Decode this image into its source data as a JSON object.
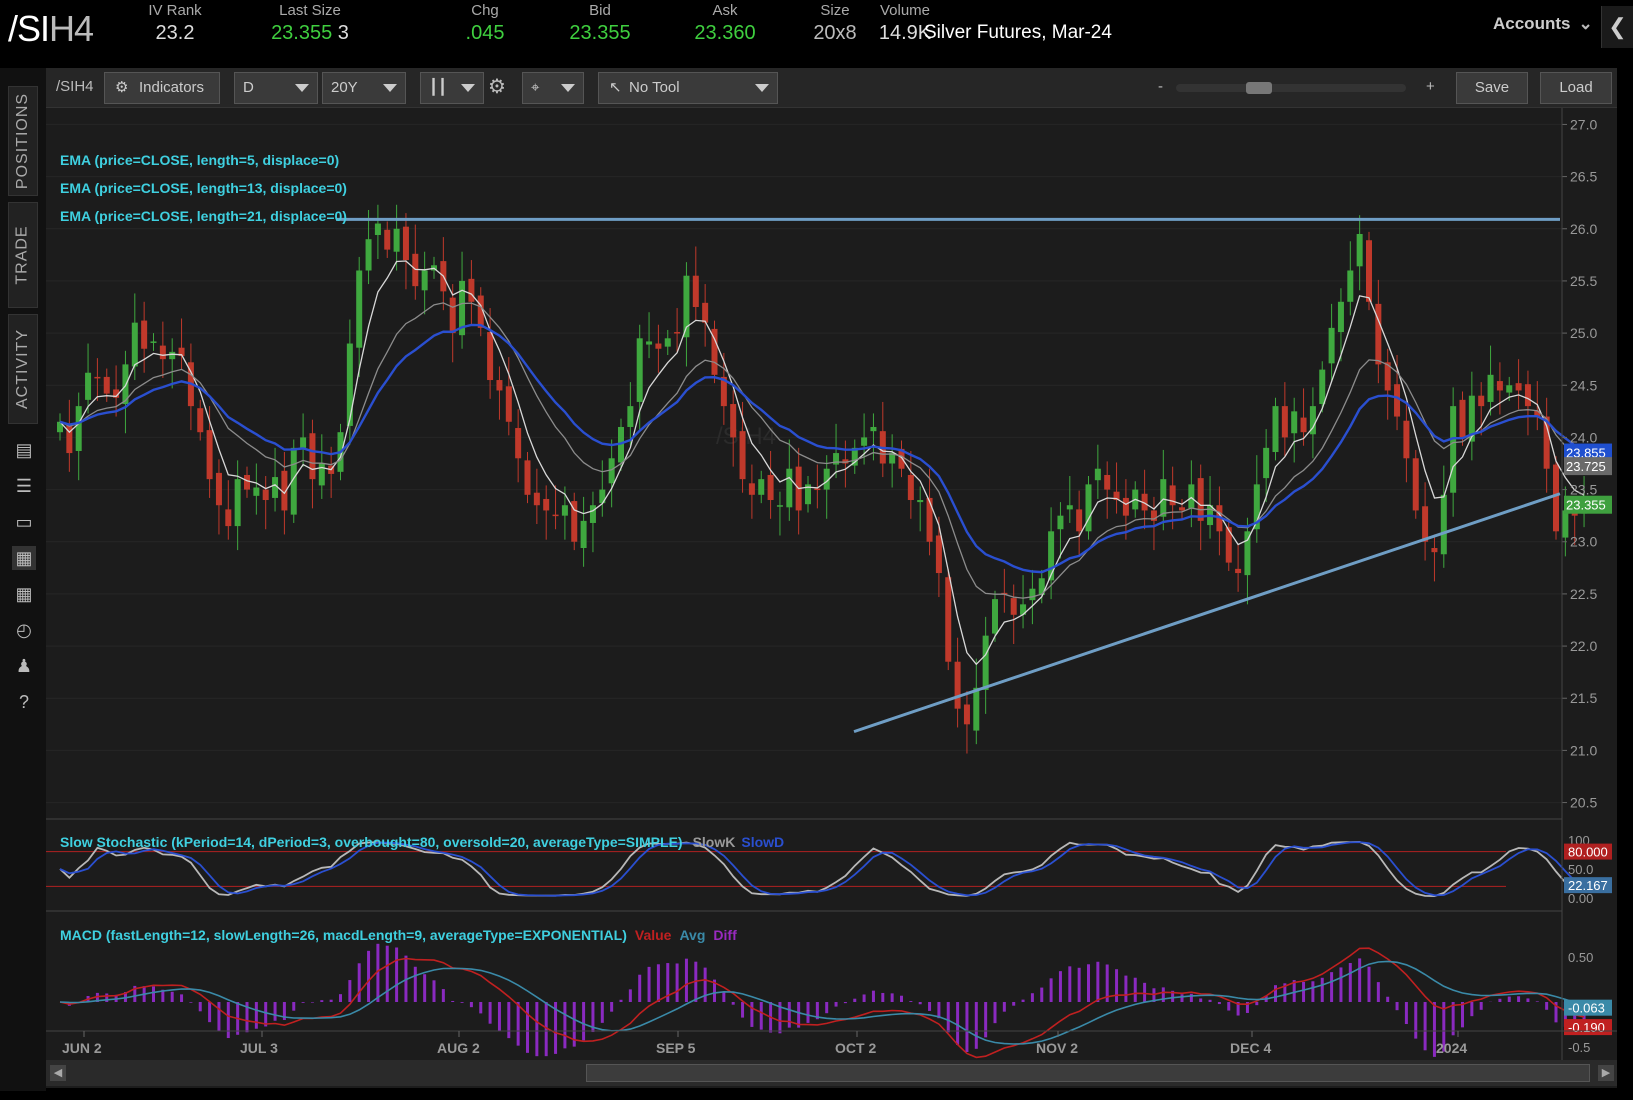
{
  "header": {
    "symbol_a": "/SI",
    "symbol_b": "H4",
    "quotes": [
      {
        "label": "IV Rank",
        "value": "23.2",
        "color": "#dddddd"
      },
      {
        "label": "Last Size",
        "value": "23.355",
        "value2": "3",
        "color": "#3fcf3f"
      },
      {
        "label": "Chg",
        "value": ".045",
        "color": "#3fcf3f"
      },
      {
        "label": "Bid",
        "value": "23.355",
        "color": "#3fcf3f"
      },
      {
        "label": "Ask",
        "value": "23.360",
        "color": "#3fcf3f"
      },
      {
        "label": "Size",
        "value": "20x8",
        "color": "#bbbbbb"
      },
      {
        "label": "Volume",
        "value": "14.9K",
        "color": "#dddddd"
      }
    ],
    "description": "Silver Futures, Mar-24",
    "accounts": "Accounts"
  },
  "sidebar": {
    "tabs": [
      "POSITIONS",
      "TRADE",
      "ACTIVITY"
    ],
    "icons": [
      "monitor-icon",
      "list-icon",
      "tv-icon",
      "chart-icon",
      "grid-icon",
      "history-icon",
      "people-icon",
      "help-icon"
    ]
  },
  "toolbar": {
    "symbol": "/SIH4",
    "indicators": "Indicators",
    "interval": "D",
    "range": "20Y",
    "tool": "No Tool",
    "zoom_minus": "-",
    "zoom_plus": "+",
    "save": "Save",
    "load": "Load"
  },
  "study_labels": {
    "ema1": "EMA (price=CLOSE, length=5, displace=0)",
    "ema2": "EMA (price=CLOSE, length=13, displace=0)",
    "ema3": "EMA (price=CLOSE, length=21, displace=0)",
    "stoch": "Slow Stochastic (kPeriod=14, dPeriod=3, overbought=80, oversold=20, averageType=SIMPLE)",
    "stoch_k": "SlowK",
    "stoch_d": "SlowD",
    "macd": "MACD (fastLength=12, slowLength=26, macdLength=9, averageType=EXPONENTIAL)",
    "macd_value": "Value",
    "macd_avg": "Avg",
    "macd_diff": "Diff",
    "watermark": "/SIH4"
  },
  "chart_data": {
    "type": "candlestick",
    "y_ticks": [
      "27.0",
      "26.5",
      "26.0",
      "25.5",
      "25.0",
      "24.5",
      "24.0",
      "23.5",
      "23.0",
      "22.5",
      "22.0",
      "21.5",
      "21.0",
      "20.5"
    ],
    "ylim": [
      20.4,
      27.1
    ],
    "x_labels": [
      "JUN 2",
      "JUL 3",
      "AUG 2",
      "SEP 5",
      "OCT 2",
      "NOV 2",
      "DEC 4",
      "2024"
    ],
    "price_badges": [
      {
        "value": "23.855",
        "color": "#1f4fcf"
      },
      {
        "value": "23.725",
        "color": "#6a6a6a"
      },
      {
        "value": "23.355",
        "color": "#3fa03f"
      }
    ],
    "resistance_level": 26.09,
    "trendline": {
      "from": [
        21.18
      ],
      "to": [
        23.46
      ]
    },
    "closes": [
      24.15,
      23.85,
      24.3,
      24.62,
      24.58,
      24.42,
      24.38,
      24.7,
      25.1,
      24.85,
      24.92,
      24.75,
      24.82,
      24.78,
      24.3,
      24.05,
      23.6,
      23.35,
      23.15,
      23.6,
      23.5,
      23.52,
      23.4,
      23.62,
      23.3,
      23.9,
      24.0,
      23.6,
      23.75,
      23.65,
      24.05,
      24.9,
      25.6,
      25.9,
      26.05,
      25.8,
      26.0,
      25.7,
      25.45,
      25.6,
      25.65,
      25.4,
      25.0,
      25.5,
      25.3,
      25.05,
      24.55,
      24.45,
      24.15,
      23.8,
      23.45,
      23.35,
      23.3,
      23.25,
      23.35,
      23.0,
      23.2,
      23.35,
      23.5,
      23.8,
      24.1,
      24.3,
      24.95,
      24.92,
      24.85,
      24.95,
      25.0,
      25.55,
      25.25,
      25.1,
      24.6,
      24.3,
      24.0,
      23.6,
      23.45,
      23.6,
      23.4,
      23.35,
      23.7,
      23.3,
      23.55,
      23.5,
      23.7,
      23.85,
      23.75,
      23.9,
      24.0,
      24.1,
      23.75,
      23.85,
      23.7,
      23.4,
      23.4,
      23.0,
      22.7,
      21.85,
      21.4,
      21.25,
      21.6,
      22.1,
      22.45,
      22.5,
      22.3,
      22.4,
      22.55,
      22.65,
      23.1,
      23.25,
      23.35,
      23.1,
      23.55,
      23.7,
      23.5,
      23.4,
      23.25,
      23.5,
      23.3,
      23.2,
      23.6,
      23.35,
      23.3,
      23.55,
      23.2,
      23.35,
      23.1,
      22.8,
      22.7,
      23.1,
      23.55,
      23.9,
      24.3,
      24.0,
      24.25,
      24.05,
      24.3,
      24.65,
      25.05,
      25.3,
      25.6,
      25.95,
      25.3,
      24.7,
      24.45,
      24.2,
      23.8,
      23.3,
      23.0,
      22.9,
      23.45,
      24.3,
      24.0,
      24.4,
      24.3,
      24.6,
      24.45,
      24.5,
      24.45,
      24.3,
      24.2,
      23.7,
      23.1,
      23.3,
      23.25,
      23.35
    ]
  },
  "stoch_axis": [
    "100",
    "80.000",
    "50.0",
    "22.167",
    "0.00"
  ],
  "macd_axis": [
    "0.50",
    "-0.063",
    "-0.190",
    "-0.5"
  ]
}
